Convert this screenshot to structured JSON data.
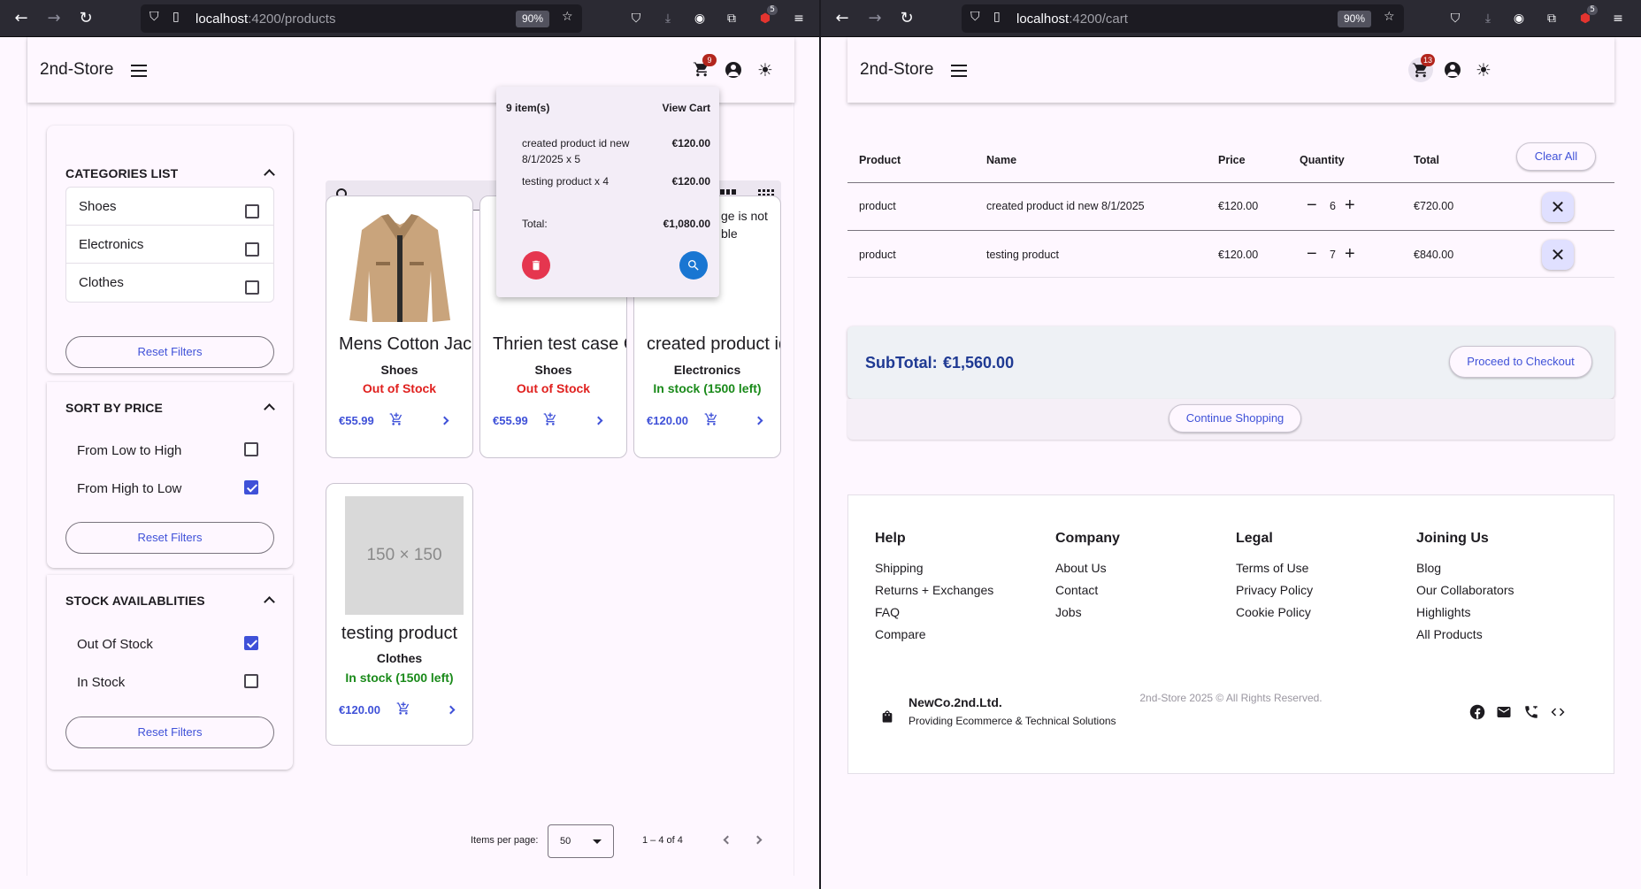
{
  "left": {
    "url_host": "localhost",
    "url_path": ":4200/products",
    "zoom": "90%",
    "ext_badge": "5",
    "brand": "2nd-Store",
    "cart_count": "9",
    "filters": {
      "categories_title": "CATEGORIES LIST",
      "categories": [
        "Shoes",
        "Electronics",
        "Clothes"
      ],
      "sort_title": "SORT BY PRICE",
      "sort_options": [
        {
          "label": "From Low to High",
          "checked": false
        },
        {
          "label": "From High to Low",
          "checked": true
        }
      ],
      "stock_title": "STOCK AVAILABLITIES",
      "stock_options": [
        {
          "label": "Out Of Stock",
          "checked": true
        },
        {
          "label": "In Stock",
          "checked": false
        }
      ],
      "reset_label": "Reset Filters"
    },
    "products": [
      {
        "title": "Mens Cotton Jacket",
        "category": "Shoes",
        "stock": "Out of Stock",
        "price": "€55.99"
      },
      {
        "title": "Thrien test case C",
        "category": "Shoes",
        "stock": "Out of Stock",
        "price": "€55.99"
      },
      {
        "title": "created product id new",
        "category": "Electronics",
        "stock": "In stock (1500 left)",
        "price": "€120.00",
        "img_alt_line1": "ge is not",
        "img_alt_line2": "ble"
      },
      {
        "title": "testing product",
        "category": "Clothes",
        "stock": "In stock (1500 left)",
        "price": "€120.00",
        "placeholder": "150 × 150"
      }
    ],
    "mini_cart": {
      "count_label": "9 item(s)",
      "view_label": "View Cart",
      "items": [
        {
          "line1": "created product id new",
          "line2": "8/1/2025 x 5",
          "price": "€120.00"
        },
        {
          "line1": "testing product x 4",
          "line2": "",
          "price": "€120.00"
        }
      ],
      "total_label": "Total:",
      "total": "€1,080.00"
    },
    "pager": {
      "label": "Items per page:",
      "value": "50",
      "range": "1 – 4 of 4"
    }
  },
  "right": {
    "url_host": "localhost",
    "url_path": ":4200/cart",
    "zoom": "90%",
    "ext_badge": "5",
    "brand": "2nd-Store",
    "cart_count": "13",
    "table": {
      "headers": [
        "Product",
        "Name",
        "Price",
        "Quantity",
        "Total"
      ],
      "clear_label": "Clear All",
      "rows": [
        {
          "product": "product",
          "name": "created product id new 8/1/2025",
          "price": "€120.00",
          "qty": "6",
          "total": "€720.00"
        },
        {
          "product": "product",
          "name": "testing product",
          "price": "€120.00",
          "qty": "7",
          "total": "€840.00"
        }
      ]
    },
    "subtotal_label": "SubTotal:",
    "subtotal": "€1,560.00",
    "checkout_label": "Proceed to Checkout",
    "continue_label": "Continue Shopping",
    "footer": {
      "columns": [
        {
          "title": "Help",
          "links": [
            "Shipping",
            "Returns + Exchanges",
            "FAQ",
            "Compare"
          ]
        },
        {
          "title": "Company",
          "links": [
            "About Us",
            "Contact",
            "Jobs"
          ]
        },
        {
          "title": "Legal",
          "links": [
            "Terms of Use",
            "Privacy Policy",
            "Cookie Policy"
          ]
        },
        {
          "title": "Joining Us",
          "links": [
            "Blog",
            "Our Collaborators",
            "Highlights",
            "All Products"
          ]
        }
      ],
      "copyright": "2nd-Store 2025 © All Rights Reserved.",
      "company": "NewCo.2nd.Ltd.",
      "tagline": "Providing Ecommerce & Technical Solutions",
      "socials": [
        "facebook-icon",
        "mail-icon",
        "phone-icon",
        "code-icon"
      ]
    }
  },
  "colors": {
    "accent": "#3f51d8",
    "out_of_stock": "#e0201e",
    "in_stock": "#1a8a1a",
    "badge": "#b3261e"
  }
}
